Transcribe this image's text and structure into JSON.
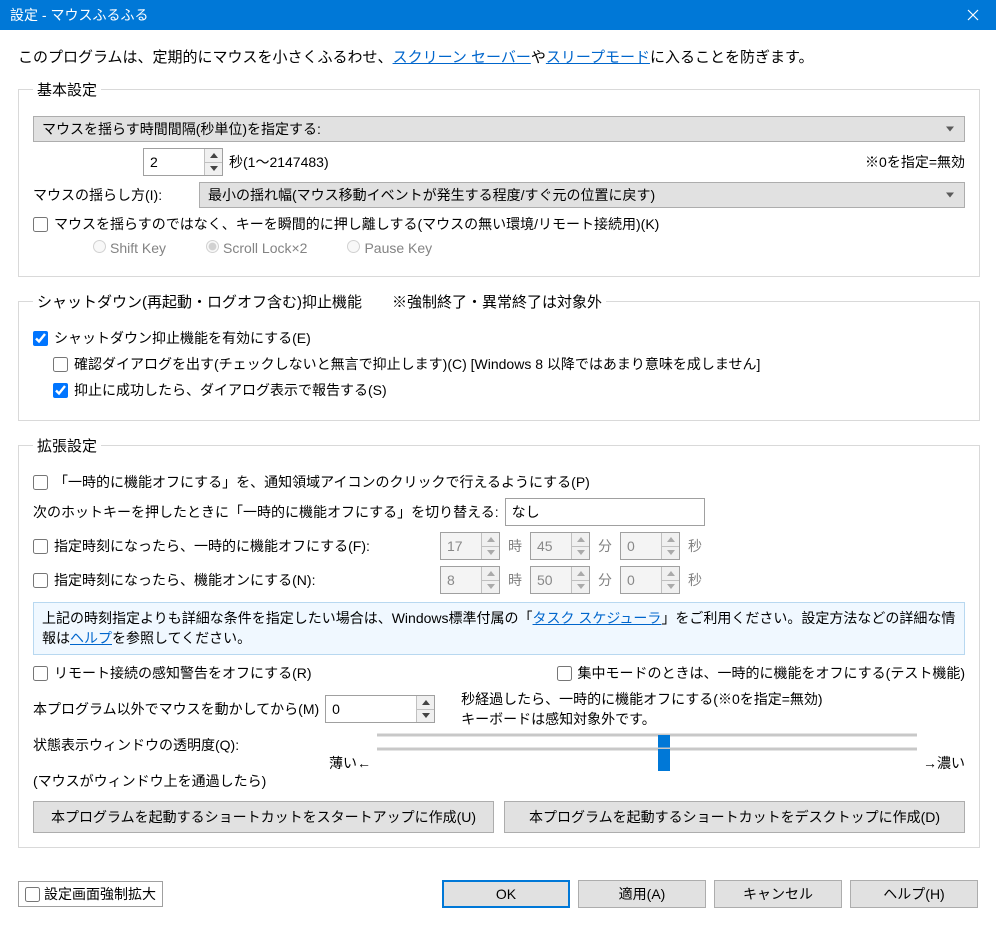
{
  "title": "設定 - マウスふるふる",
  "intro": {
    "p1": "このプログラムは、定期的にマウスを小さくふるわせ、",
    "l1": "スクリーン セーバー",
    "p2": "や",
    "l2": "スリープモード",
    "p3": "に入ることを防ぎます。"
  },
  "basic": {
    "legend": "基本設定",
    "interval_combo": "マウスを揺らす時間間隔(秒単位)を指定する:",
    "interval_value": "2",
    "interval_unit": "秒(1～2147483)",
    "interval_note": "※0を指定=無効",
    "method_label": "マウスの揺らし方(I):",
    "method_combo": "最小の揺れ幅(マウス移動イベントが発生する程度/すぐ元の位置に戻す)",
    "key_check": "マウスを揺らすのではなく、キーを瞬間的に押し離しする(マウスの無い環境/リモート接続用)(K)",
    "radio1": "Shift Key",
    "radio2": "Scroll Lock×2",
    "radio3": "Pause Key"
  },
  "shutdown": {
    "legend": "シャットダウン(再起動・ログオフ含む)抑止機能　　※強制終了・異常終了は対象外",
    "enable": "シャットダウン抑止機能を有効にする(E)",
    "confirm": "確認ダイアログを出す(チェックしないと無言で抑止します)(C) [Windows 8 以降ではあまり意味を成しません]",
    "report": "抑止に成功したら、ダイアログ表示で報告する(S)"
  },
  "ext": {
    "legend": "拡張設定",
    "pause_tray": "「一時的に機能オフにする」を、通知領域アイコンのクリックで行えるようにする(P)",
    "hotkey_label": "次のホットキーを押したときに「一時的に機能オフにする」を切り替える:",
    "hotkey_value": "なし",
    "off_time": "指定時刻になったら、一時的に機能オフにする(F):",
    "on_time": "指定時刻になったら、機能オンにする(N):",
    "t_off_h": "17",
    "t_off_m": "45",
    "t_off_s": "0",
    "t_on_h": "8",
    "t_on_m": "50",
    "t_on_s": "0",
    "hour": "時",
    "min": "分",
    "sec": "秒",
    "info1": "上記の時刻指定よりも詳細な条件を指定したい場合は、Windows標準付属の「",
    "info_link1": "タスク スケジューラ",
    "info2": "」をご利用ください。設定方法などの詳細な情報は",
    "info_link2": "ヘルプ",
    "info3": "を参照してください。",
    "remote_warn": "リモート接続の感知警告をオフにする(R)",
    "focus_mode": "集中モードのときは、一時的に機能をオフにする(テスト機能)",
    "other_mouse_label": "本プログラム以外でマウスを動かしてから(M)",
    "other_mouse_value": "0",
    "other_mouse_desc1": "秒経過したら、一時的に機能オフにする(※0を指定=無効)",
    "other_mouse_desc2": "キーボードは感知対象外です。",
    "opacity_label": "状態表示ウィンドウの透明度(Q):",
    "opacity_sub": "(マウスがウィンドウ上を通過したら)",
    "thin": "薄い←",
    "thick": "→濃い",
    "shortcut_startup": "本プログラムを起動するショートカットをスタートアップに作成(U)",
    "shortcut_desktop": "本プログラムを起動するショートカットをデスクトップに作成(D)"
  },
  "footer": {
    "force_zoom": "設定画面強制拡大",
    "ok": "OK",
    "apply": "適用(A)",
    "cancel": "キャンセル",
    "help": "ヘルプ(H)"
  }
}
